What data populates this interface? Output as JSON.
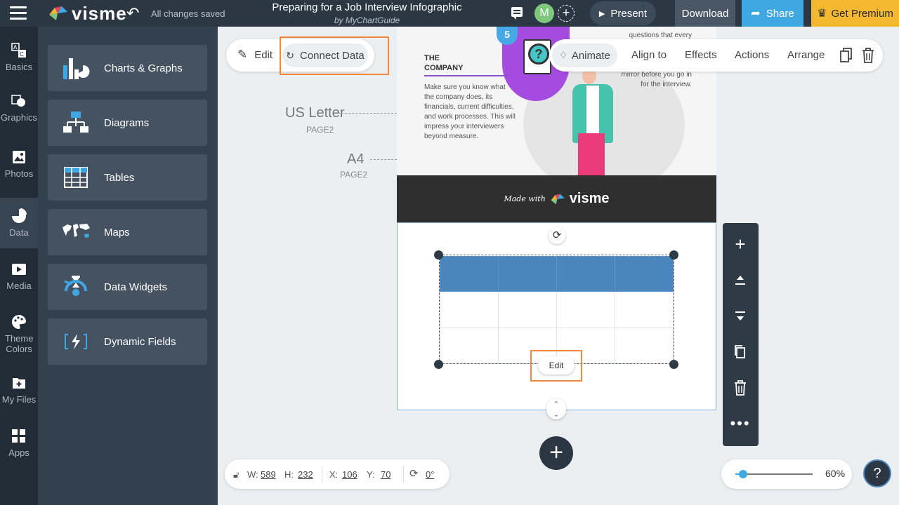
{
  "header": {
    "logo_text": "visme",
    "save_status": "All changes saved",
    "doc_title": "Preparing for a Job Interview Infographic",
    "doc_subtitle": "by MyChartGuide",
    "avatar_initial": "M",
    "present_label": "Present",
    "download_label": "Download",
    "share_label": "Share",
    "premium_label": "Get Premium"
  },
  "rail": [
    {
      "label": "Basics",
      "icon": "basics-icon"
    },
    {
      "label": "Graphics",
      "icon": "graphics-icon"
    },
    {
      "label": "Photos",
      "icon": "photos-icon"
    },
    {
      "label": "Data",
      "icon": "data-icon",
      "active": true
    },
    {
      "label": "Media",
      "icon": "media-icon"
    },
    {
      "label": "Theme Colors",
      "icon": "palette-icon"
    },
    {
      "label": "My Files",
      "icon": "files-icon"
    },
    {
      "label": "Apps",
      "icon": "apps-icon"
    }
  ],
  "panel": [
    {
      "label": "Charts & Graphs",
      "icon": "chart-icon"
    },
    {
      "label": "Diagrams",
      "icon": "diagram-icon"
    },
    {
      "label": "Tables",
      "icon": "table-icon"
    },
    {
      "label": "Maps",
      "icon": "world-map-icon"
    },
    {
      "label": "Data Widgets",
      "icon": "widget-icon"
    },
    {
      "label": "Dynamic Fields",
      "icon": "dynamic-fields-icon"
    }
  ],
  "toolbar_left": {
    "edit_label": "Edit",
    "connect_label": "Connect Data"
  },
  "toolbar_right": {
    "animate_label": "Animate",
    "align_label": "Align to",
    "effects_label": "Effects",
    "actions_label": "Actions",
    "arrange_label": "Arrange"
  },
  "page_sizes": [
    {
      "name": "US Letter",
      "sub": "PAGE2"
    },
    {
      "name": "A4",
      "sub": "PAGE2"
    }
  ],
  "infographic": {
    "badge_number": "5",
    "company_title_line1": "THE",
    "company_title_line2": "COMPANY",
    "company_body": "Make sure you know what the company does, its financials, current difficulties, and work processes. This will impress your interviewers beyond measure.",
    "side_text_top": "questions that every",
    "side_text_bottom": "mirror before you go in for the interview.",
    "made_with": "Made with",
    "made_with_logo": "visme"
  },
  "table": {
    "edit_label": "Edit",
    "header_color": "#4a86bd"
  },
  "vertical_tools": [
    "add-icon",
    "move-up-icon",
    "move-down-icon",
    "duplicate-icon",
    "trash-icon",
    "more-icon"
  ],
  "dimensions": {
    "w_label": "W:",
    "w_value": "589",
    "h_label": "H:",
    "h_value": "232",
    "x_label": "X:",
    "x_value": "106",
    "y_label": "Y:",
    "y_value": "70",
    "rotation_value": "0°"
  },
  "zoom": {
    "value": "60%",
    "level": 0.1
  },
  "help_label": "?",
  "colors": {
    "accent": "#3fa8e3",
    "premium": "#f4b830",
    "highlight": "#f0883e",
    "topbar": "#2c3744"
  }
}
